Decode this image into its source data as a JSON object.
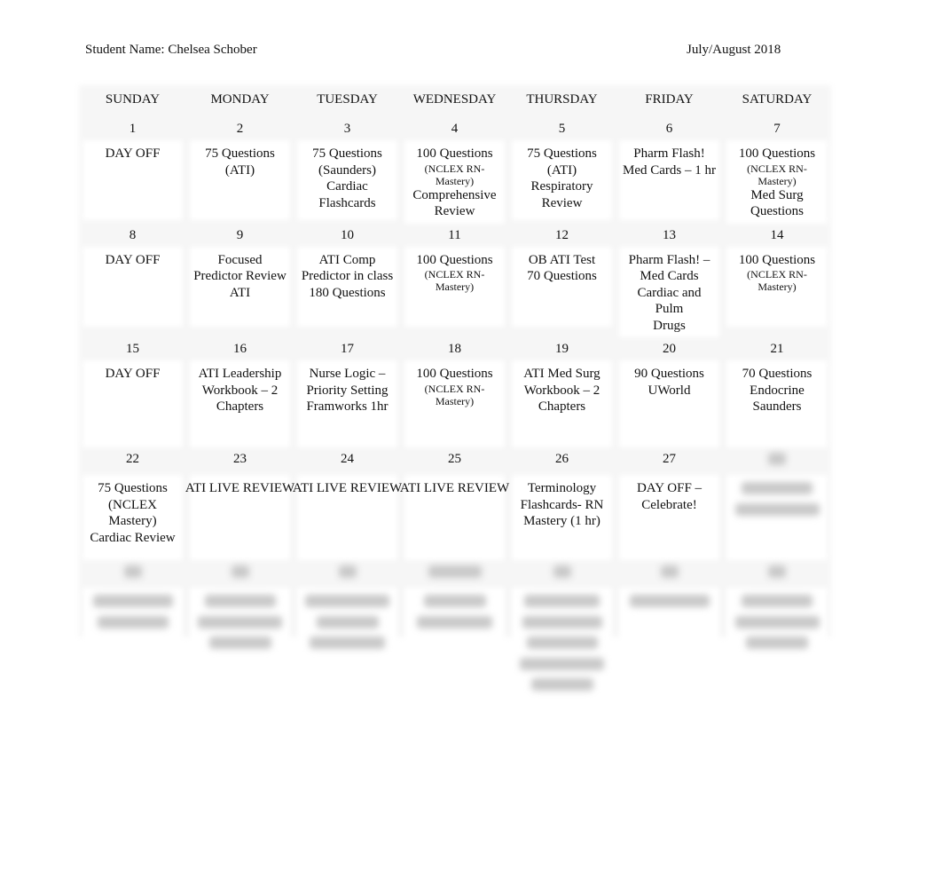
{
  "header": {
    "student_label": "Student Name: Chelsea Schober",
    "period": "July/August 2018"
  },
  "days_of_week": [
    "SUNDAY",
    "MONDAY",
    "TUESDAY",
    "WEDNESDAY",
    "THURSDAY",
    "FRIDAY",
    "SATURDAY"
  ],
  "weeks": [
    {
      "days": [
        {
          "date": "1",
          "lines": [
            "DAY OFF"
          ]
        },
        {
          "date": "2",
          "lines": [
            "75 Questions",
            "(ATI)"
          ]
        },
        {
          "date": "3",
          "lines": [
            "75 Questions",
            "(Saunders)",
            "Cardiac",
            "Flashcards"
          ]
        },
        {
          "date": "4",
          "lines": [
            "100 Questions"
          ],
          "small": "(NCLEX RN-Mastery)",
          "after": [
            "Comprehensive",
            "Review"
          ]
        },
        {
          "date": "5",
          "lines": [
            "75 Questions",
            "(ATI)",
            "Respiratory",
            "Review"
          ]
        },
        {
          "date": "6",
          "lines": [
            "Pharm Flash!",
            "Med Cards – 1 hr"
          ]
        },
        {
          "date": "7",
          "lines": [
            "100 Questions"
          ],
          "small": "(NCLEX RN-Mastery)",
          "after": [
            "Med Surg",
            "Questions"
          ]
        }
      ]
    },
    {
      "days": [
        {
          "date": "8",
          "lines": [
            "DAY OFF"
          ]
        },
        {
          "date": "9",
          "lines": [
            "Focused",
            "Predictor Review",
            "ATI"
          ]
        },
        {
          "date": "10",
          "lines": [
            "ATI Comp",
            "Predictor in class",
            "180 Questions"
          ]
        },
        {
          "date": "11",
          "lines": [
            "100 Questions"
          ],
          "small": "(NCLEX RN-Mastery)",
          "after": []
        },
        {
          "date": "12",
          "lines": [
            "OB ATI Test",
            "70 Questions"
          ]
        },
        {
          "date": "13",
          "lines": [
            "Pharm Flash! –",
            "Med Cards",
            "Cardiac and Pulm",
            "Drugs"
          ]
        },
        {
          "date": "14",
          "lines": [
            "100 Questions"
          ],
          "small": "(NCLEX RN-Mastery)",
          "after": []
        }
      ]
    },
    {
      "days": [
        {
          "date": "15",
          "lines": [
            "DAY OFF"
          ]
        },
        {
          "date": "16",
          "lines": [
            "ATI Leadership",
            "Workbook – 2",
            "Chapters"
          ]
        },
        {
          "date": "17",
          "lines": [
            "Nurse Logic –",
            "Priority Setting",
            "Framworks 1hr"
          ]
        },
        {
          "date": "18",
          "lines": [
            "100 Questions"
          ],
          "small": "(NCLEX RN-Mastery)",
          "after": []
        },
        {
          "date": "19",
          "lines": [
            "ATI Med Surg",
            "Workbook – 2",
            "Chapters"
          ]
        },
        {
          "date": "20",
          "lines": [
            "90 Questions",
            "UWorld"
          ]
        },
        {
          "date": "21",
          "lines": [
            "70 Questions",
            "Endocrine",
            "Saunders"
          ]
        }
      ]
    },
    {
      "days": [
        {
          "date": "22",
          "lines": [
            "75 Questions",
            "(NCLEX Mastery)",
            "Cardiac Review"
          ]
        },
        {
          "date": "23",
          "lines": [
            "ATI LIVE REVIEW"
          ],
          "nowrap": true
        },
        {
          "date": "24",
          "lines": [
            "ATI LIVE REVIEW"
          ],
          "nowrap": true
        },
        {
          "date": "25",
          "lines": [
            "ATI LIVE REVIEW"
          ],
          "nowrap": true
        },
        {
          "date": "26",
          "lines": [
            "Terminology",
            "Flashcards- RN",
            "Mastery (1 hr)"
          ]
        },
        {
          "date": "27",
          "lines": [
            "DAY OFF –",
            "Celebrate!"
          ]
        },
        {
          "date": "",
          "lines": [],
          "obscured": true,
          "obscured_lines": 2
        }
      ]
    },
    {
      "obscured": true,
      "days": [
        {
          "date": "",
          "obscured": true,
          "obscured_lines": 2
        },
        {
          "date": "",
          "obscured": true,
          "obscured_lines": 3
        },
        {
          "date": "",
          "obscured": true,
          "obscured_lines": 3
        },
        {
          "date": "",
          "obscured": true,
          "obscured_lines": 2
        },
        {
          "date": "",
          "obscured": true,
          "obscured_lines": 5
        },
        {
          "date": "",
          "obscured": true,
          "obscured_lines": 1
        },
        {
          "date": "",
          "obscured": true,
          "obscured_lines": 3
        }
      ]
    }
  ]
}
